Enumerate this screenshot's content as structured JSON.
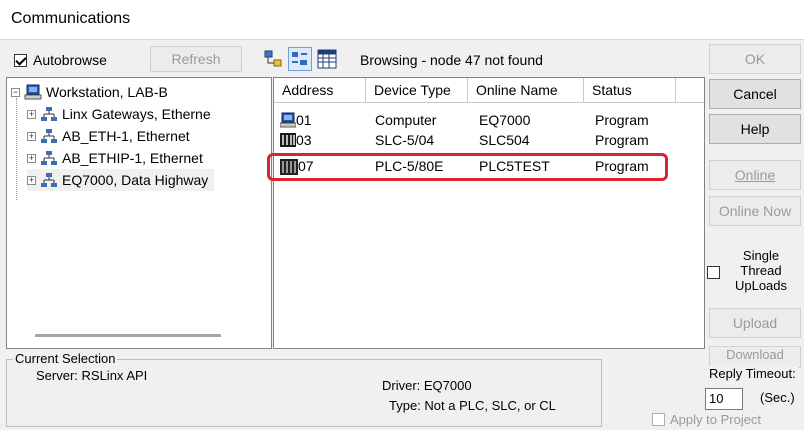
{
  "window": {
    "title": "Communications"
  },
  "toolbar": {
    "autobrowse_label": "Autobrowse",
    "autobrowse_checked": true,
    "refresh_label": "Refresh",
    "status_text": "Browsing - node 47 not found"
  },
  "tree": {
    "root": "Workstation, LAB-B",
    "items": [
      {
        "label": "Linx Gateways, Etherne"
      },
      {
        "label": "AB_ETH-1, Ethernet"
      },
      {
        "label": "AB_ETHIP-1, Ethernet"
      },
      {
        "label": "EQ7000, Data Highway"
      }
    ]
  },
  "device_table": {
    "columns": [
      "Address",
      "Device Type",
      "Online Name",
      "Status"
    ],
    "rows": [
      {
        "address": "01",
        "device_type": "Computer",
        "online_name": "EQ7000",
        "status": "Program",
        "icon": "computer-icon"
      },
      {
        "address": "03",
        "device_type": "SLC-5/04",
        "online_name": "SLC504",
        "status": "Program",
        "icon": "slc-icon"
      },
      {
        "address": "07",
        "device_type": "PLC-5/80E",
        "online_name": "PLC5TEST",
        "status": "Program",
        "icon": "plc-icon"
      }
    ],
    "highlight_color": "#d7262e"
  },
  "buttons": {
    "ok": "OK",
    "cancel": "Cancel",
    "help": "Help",
    "online": "Online",
    "online_now": "Online Now",
    "upload": "Upload",
    "download": "Download"
  },
  "single_thread": {
    "line1": "Single",
    "line2": "Thread",
    "line3": "UpLoads"
  },
  "reply_timeout": {
    "label": "Reply Timeout:",
    "value": "10",
    "unit": "(Sec.)"
  },
  "apply_to_project": "Apply to Project",
  "current_selection": {
    "legend": "Current Selection",
    "server": "Server: RSLinx API",
    "driver": "Driver: EQ7000",
    "type": "Type: Not a PLC, SLC, or CL"
  }
}
